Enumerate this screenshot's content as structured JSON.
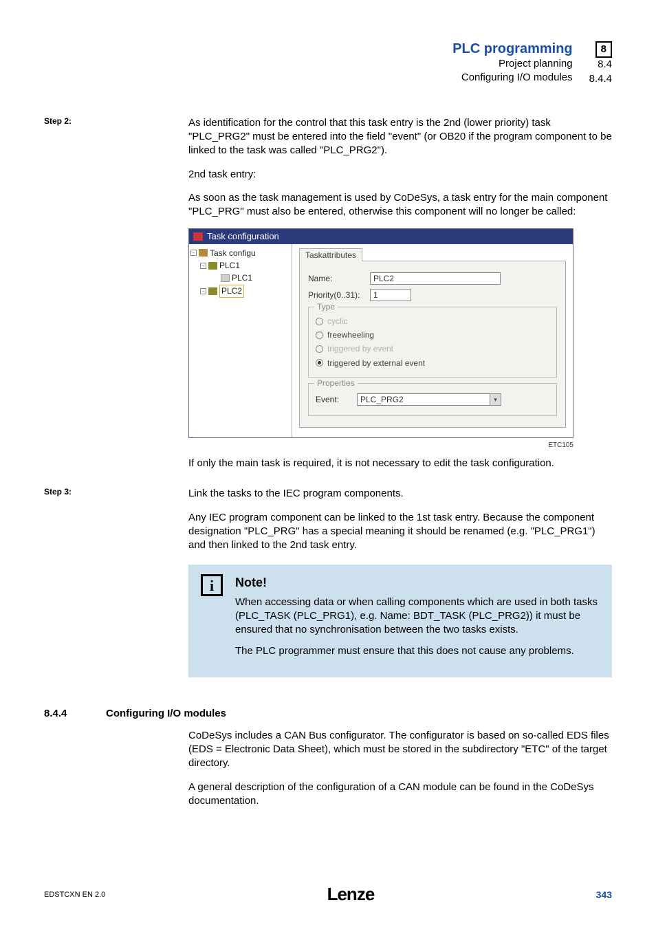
{
  "header": {
    "main_title": "PLC programming",
    "sub1": "Project planning",
    "sub2": "Configuring I/O modules",
    "chapter_boxed": "8",
    "sec1": "8.4",
    "sec2": "8.4.4"
  },
  "step2": {
    "label": "Step 2:",
    "p1": "As identification for the control that this task entry is the 2nd (lower priority) task \"PLC_PRG2\" must be entered into the field \"event\" (or OB20 if the program component to be linked to the task was called \"PLC_PRG2\").",
    "p2": "2nd task entry:",
    "p3": "As soon as the task management is used by CoDeSys, a task entry for the main component \"PLC_PRG\" must also be entered, otherwise this component will no longer be called:"
  },
  "screenshot": {
    "window_title": "Task configuration",
    "tree": {
      "root": "Task configu",
      "node_plc1": "PLC1",
      "leaf_plc1": "PLC1",
      "node_plc2": "PLC2"
    },
    "tab": "Taskattributes",
    "name_label": "Name:",
    "name_value": "PLC2",
    "priority_label": "Priority(0..31):",
    "priority_value": "1",
    "type_legend": "Type",
    "radio_cyclic": "cyclic",
    "radio_freewheeling": "freewheeling",
    "radio_triggered_event": "triggered by event",
    "radio_triggered_external": "triggered by external event",
    "properties_legend": "Properties",
    "event_label": "Event:",
    "event_value": "PLC_PRG2",
    "caption": "ETC105"
  },
  "after_shot": "If only the main task is required, it is not necessary to edit the task configuration.",
  "step3": {
    "label": "Step 3:",
    "p1": "Link the tasks to the IEC program components.",
    "p2": "Any IEC program component can be linked to the 1st task entry. Because the component designation \"PLC_PRG\" has a special meaning it should be renamed (e.g. \"PLC_PRG1\") and then linked to the 2nd task entry."
  },
  "note": {
    "title": "Note!",
    "body1": "When accessing data or when calling components which are used in both tasks (PLC_TASK (PLC_PRG1), e.g. Name: BDT_TASK (PLC_PRG2)) it must be ensured that no synchronisation between the two tasks exists.",
    "body2": "The PLC programmer must ensure that this does not cause any problems."
  },
  "section": {
    "num": "8.4.4",
    "title": "Configuring I/O modules",
    "p1": "CoDeSys includes a CAN Bus configurator. The configurator is based on so-called EDS files (EDS = Electronic Data Sheet), which must be stored in the subdirectory \"ETC\" of the target directory.",
    "p2": "A general description of the configuration of a CAN module can be found in the CoDeSys documentation."
  },
  "footer": {
    "left": "EDSTCXN  EN   2.0",
    "logo": "Lenze",
    "page": "343"
  }
}
